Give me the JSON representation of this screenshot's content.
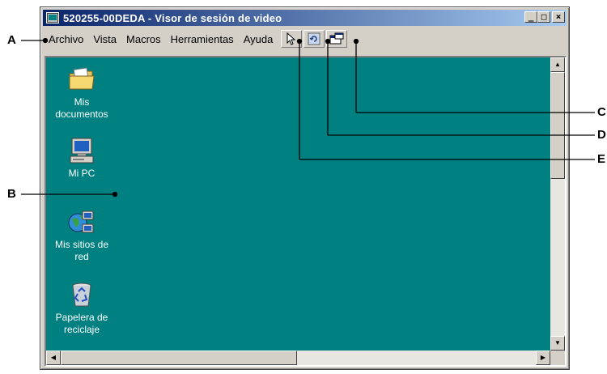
{
  "window": {
    "title": "520255-00DEDA - Visor de sesión de video",
    "controls": {
      "minimize": "_",
      "maximize": "□",
      "close": "×"
    }
  },
  "menu": {
    "items": [
      "Archivo",
      "Vista",
      "Macros",
      "Herramientas",
      "Ayuda"
    ]
  },
  "toolbar": {
    "buttons": [
      {
        "icon": "pointer-icon"
      },
      {
        "icon": "refresh-icon"
      },
      {
        "icon": "window-toggle-icon"
      }
    ]
  },
  "desktop": {
    "icons": [
      {
        "label_line1": "Mis",
        "label_line2": "documentos",
        "icon": "folder-icon"
      },
      {
        "label_line1": "Mi PC",
        "label_line2": "",
        "icon": "computer-icon"
      },
      {
        "label_line1": "Mis sitios de",
        "label_line2": "red",
        "icon": "network-icon"
      },
      {
        "label_line1": "Papelera de",
        "label_line2": "reciclaje",
        "icon": "recycle-bin-icon"
      }
    ],
    "background_color": "#008080"
  },
  "callouts": [
    "A",
    "B",
    "C",
    "D",
    "E"
  ]
}
